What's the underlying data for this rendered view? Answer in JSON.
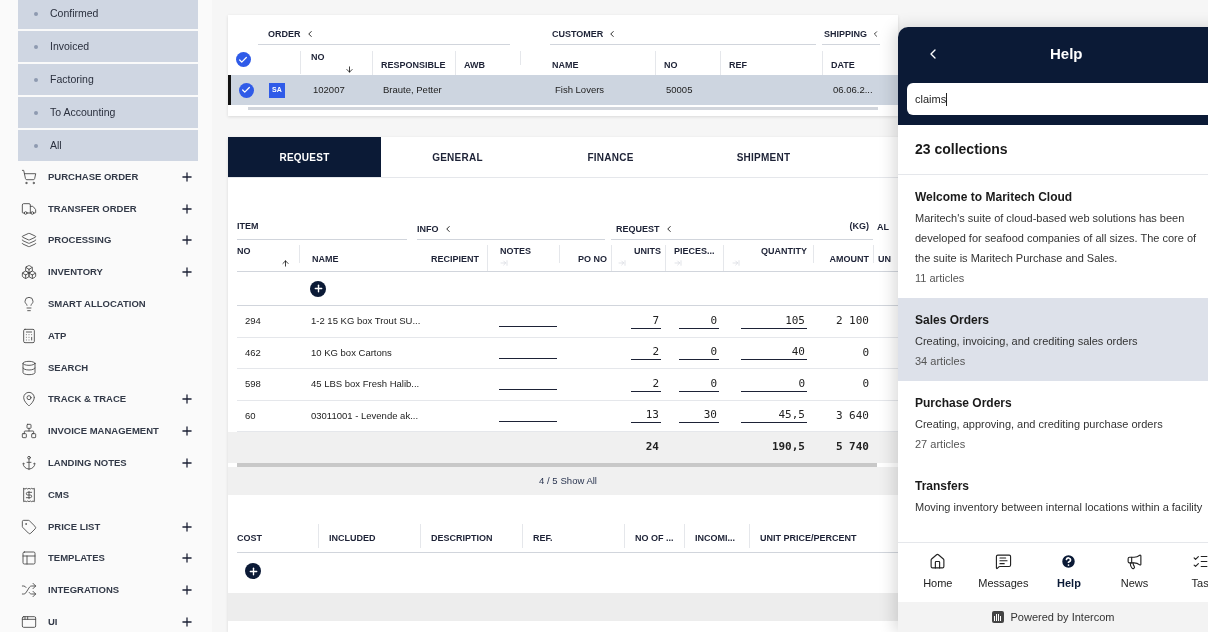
{
  "sidebar": {
    "status_items": [
      {
        "label": "Confirmed"
      },
      {
        "label": "Invoiced"
      },
      {
        "label": "Factoring"
      },
      {
        "label": "To Accounting"
      },
      {
        "label": "All"
      }
    ],
    "menu": [
      {
        "label": "PURCHASE ORDER",
        "expandable": true
      },
      {
        "label": "TRANSFER ORDER",
        "expandable": true
      },
      {
        "label": "PROCESSING",
        "expandable": true
      },
      {
        "label": "INVENTORY",
        "expandable": true
      },
      {
        "label": "SMART ALLOCATION",
        "expandable": false
      },
      {
        "label": "ATP",
        "expandable": false
      },
      {
        "label": "SEARCH",
        "expandable": false
      },
      {
        "label": "TRACK & TRACE",
        "expandable": true
      },
      {
        "label": "INVOICE MANAGEMENT",
        "expandable": true
      },
      {
        "label": "LANDING NOTES",
        "expandable": true
      },
      {
        "label": "CMS",
        "expandable": false
      },
      {
        "label": "PRICE LIST",
        "expandable": true
      },
      {
        "label": "TEMPLATES",
        "expandable": true
      },
      {
        "label": "INTEGRATIONS",
        "expandable": true
      },
      {
        "label": "UI",
        "expandable": true
      }
    ]
  },
  "orders_table": {
    "group_headers": [
      "ORDER",
      "CUSTOMER",
      "SHIPPING"
    ],
    "select_all_checked": true,
    "columns": [
      "NO",
      "RESPONSIBLE",
      "AWB",
      "NAME",
      "NO",
      "REF",
      "DATE"
    ],
    "rows": [
      {
        "selected": true,
        "checked": true,
        "badge": "SA",
        "no": "102007",
        "responsible": "Braute, Petter",
        "customer_name": "Fish Lovers",
        "customer_no": "50005",
        "date": "06.06.2..."
      }
    ]
  },
  "tabs": [
    {
      "label": "REQUEST",
      "selected": true
    },
    {
      "label": "GENERAL",
      "selected": false
    },
    {
      "label": "FINANCE",
      "selected": false
    },
    {
      "label": "SHIPMENT",
      "selected": false
    }
  ],
  "items_table": {
    "group_headers": [
      "ITEM",
      "INFO",
      "REQUEST",
      "(KG)",
      "AL"
    ],
    "columns": [
      "NO",
      "NAME",
      "RECIPIENT",
      "NOTES",
      "PO NO",
      "UNITS",
      "PIECES...",
      "QUANTITY",
      "AMOUNT",
      "UN"
    ],
    "rows": [
      {
        "no": "294",
        "name": "1-2 15 KG box Trout SU...",
        "units": "7",
        "pieces": "0",
        "quantity": "105",
        "amount": "2 100"
      },
      {
        "no": "462",
        "name": "10 KG box Cartons",
        "units": "2",
        "pieces": "0",
        "quantity": "40",
        "amount": "0"
      },
      {
        "no": "598",
        "name": "45 LBS box Fresh Halib...",
        "units": "2",
        "pieces": "0",
        "quantity": "0",
        "amount": "0"
      },
      {
        "no": "60",
        "name": "03011001 - Levende ak...",
        "units": "13",
        "pieces": "30",
        "quantity": "45,5",
        "amount": "3 640"
      }
    ],
    "totals": {
      "units": "24",
      "quantity": "190,5",
      "amount": "5 740"
    },
    "pagination": {
      "count": "4 / 5",
      "link": "Show All"
    }
  },
  "cost_table": {
    "columns": [
      "COST",
      "INCLUDED",
      "DESCRIPTION",
      "REF.",
      "NO OF ...",
      "INCOMI...",
      "UNIT PRICE/PERCENT"
    ]
  },
  "help": {
    "title": "Help",
    "search_value": "claims",
    "count": "23 collections",
    "collections": [
      {
        "title": "Welcome to Maritech Cloud",
        "description": "Maritech's suite of cloud-based web solutions has been developed for seafood companies of all sizes. The core of the suite is Maritech Purchase and Sales.",
        "articles": "11 articles",
        "selected": false
      },
      {
        "title": "Sales Orders",
        "description": "Creating, invoicing, and crediting sales orders",
        "articles": "34 articles",
        "selected": true
      },
      {
        "title": "Purchase Orders",
        "description": "Creating, approving, and crediting purchase orders",
        "articles": "27 articles",
        "selected": false
      },
      {
        "title": "Transfers",
        "description": "Moving inventory between internal locations within a facility",
        "selected": false
      }
    ],
    "nav": [
      {
        "label": "Home",
        "selected": false
      },
      {
        "label": "Messages",
        "selected": false
      },
      {
        "label": "Help",
        "selected": true
      },
      {
        "label": "News",
        "selected": false
      },
      {
        "label": "Tas",
        "selected": false
      }
    ],
    "footer": "Powered by Intercom"
  }
}
